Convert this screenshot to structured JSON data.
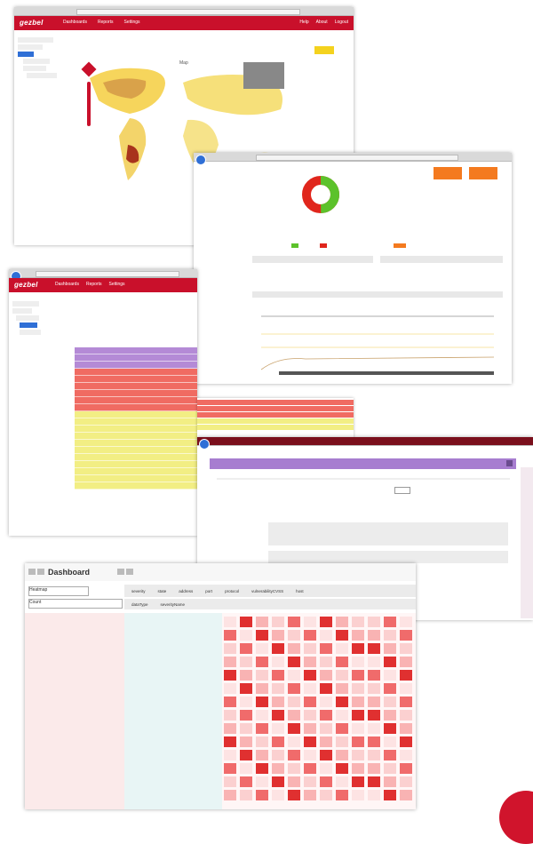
{
  "shot_map": {
    "logo": "gezbel",
    "menu": [
      "Dashboards",
      "Reports",
      "Settings"
    ],
    "right_menu": [
      "Help",
      "About",
      "Logout"
    ],
    "map_title": "Map"
  },
  "shot_donut": {
    "donut_colors": [
      "#e0261c",
      "#5cc22b"
    ],
    "orange_buttons": [
      "",
      ""
    ]
  },
  "shot_table": {
    "logo": "gezbel",
    "menu": [
      "Dashboards",
      "Reports",
      "Settings"
    ],
    "row_colors": [
      "#b48ad6",
      "#b48ad6",
      "#b48ad6",
      "#f06b62",
      "#f06b62",
      "#f06b62",
      "#f06b62",
      "#f06b62",
      "#f06b62",
      "#f2ee84",
      "#f2ee84",
      "#f2ee84",
      "#f2ee84",
      "#f2ee84",
      "#f2ee84",
      "#f2ee84",
      "#f2ee84",
      "#f2ee84",
      "#f2ee84",
      "#f2ee84"
    ]
  },
  "shot_detail": {
    "header_color": "#a77dd0"
  },
  "dashboard": {
    "title": "Dashboard",
    "filters": [
      "Heatmap",
      "Count"
    ],
    "columns": [
      "severity",
      "state",
      "address",
      "port",
      "protocol",
      "vulnerabilityCVSS",
      "host"
    ],
    "sub_columns": [
      "dataType",
      "severityName"
    ]
  }
}
